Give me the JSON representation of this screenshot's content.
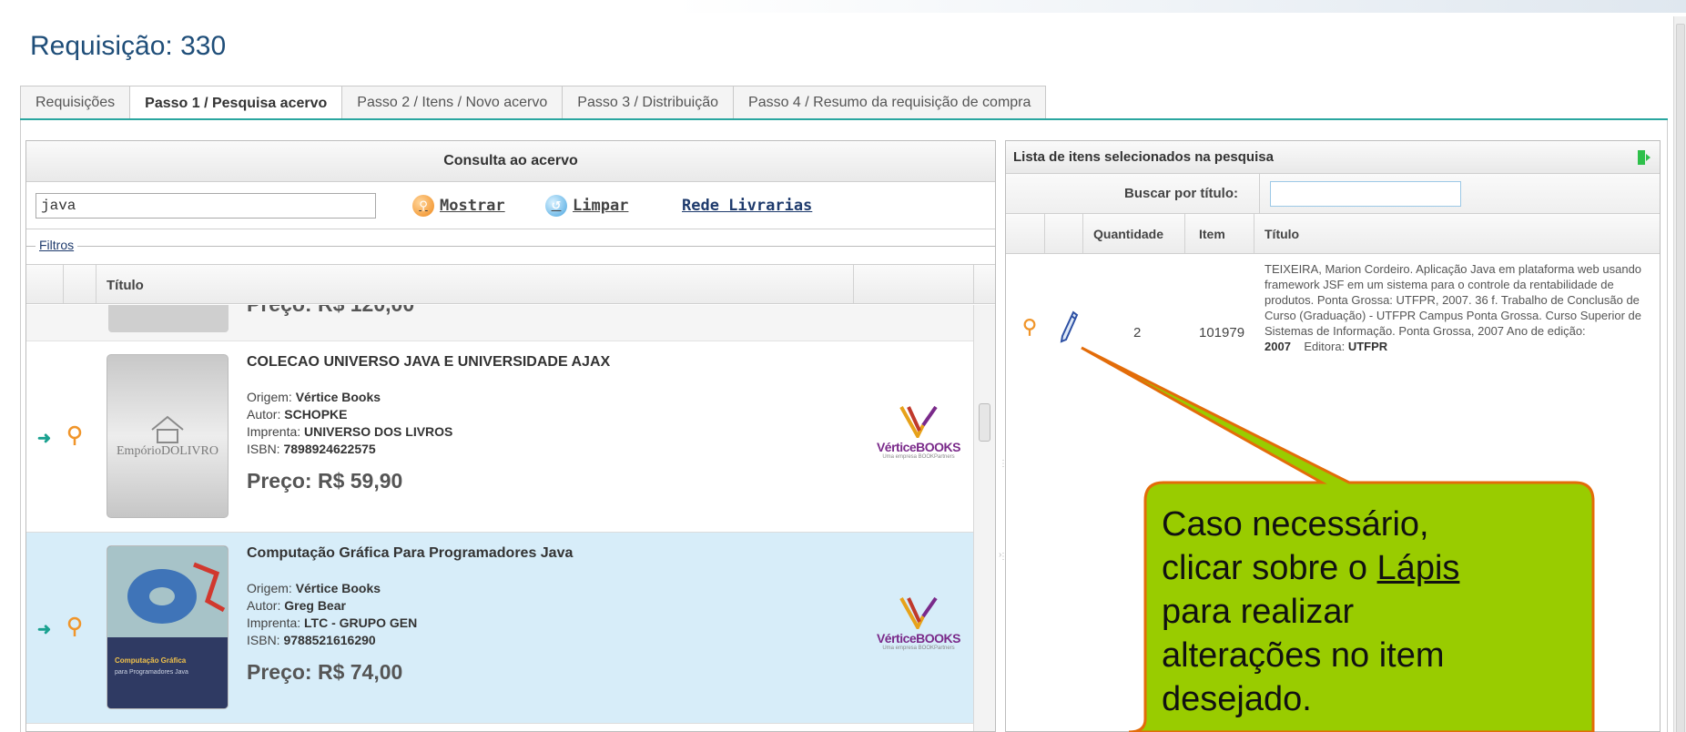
{
  "page": {
    "title": "Requisição: 330"
  },
  "tabs": [
    {
      "label": "Requisições"
    },
    {
      "label": "Passo 1 / Pesquisa acervo"
    },
    {
      "label": "Passo 2 / Itens / Novo acervo"
    },
    {
      "label": "Passo 3 / Distribuição"
    },
    {
      "label": "Passo 4 / Resumo da requisição de compra"
    }
  ],
  "left_panel": {
    "header": "Consulta ao acervo",
    "search_value": "java",
    "mostrar_label": "Mostrar",
    "limpar_label": "Limpar",
    "rede_label": "Rede Livrarias",
    "filtros_label": "Filtros",
    "col_titulo": "Título",
    "partial_price": "Preço: R$ 120,00",
    "rows": [
      {
        "title": "COLECAO UNIVERSO JAVA E UNIVERSIDADE AJAX",
        "origem_label": "Origem:",
        "origem": "Vértice Books",
        "autor_label": "Autor:",
        "autor": "SCHOPKE",
        "imprenta_label": "Imprenta:",
        "imprenta": "UNIVERSO DOS LIVROS",
        "isbn_label": "ISBN:",
        "isbn": "7898924622575",
        "price": "Preço: R$ 59,90",
        "cover_brand": "EmpórioDOLIVRO",
        "selected": false
      },
      {
        "title": "Computação Gráfica Para Programadores Java",
        "origem_label": "Origem:",
        "origem": "Vértice Books",
        "autor_label": "Autor:",
        "autor": "Greg Bear",
        "imprenta_label": "Imprenta:",
        "imprenta": "LTC - GRUPO GEN",
        "isbn_label": "ISBN:",
        "isbn": "9788521616290",
        "price": "Preço: R$ 74,00",
        "cover_brand": "Computação Gráfica para Programadores Java",
        "selected": true
      }
    ],
    "vendor_logo": "VérticeBOOKS",
    "vendor_sub": "Uma empresa BOOKPartners"
  },
  "right_panel": {
    "header": "Lista de itens selecionados na pesquisa",
    "search_label": "Buscar por título:",
    "search_value": "",
    "col_quantidade": "Quantidade",
    "col_item": "Item",
    "col_titulo": "Título",
    "row": {
      "quantidade": "2",
      "item": "101979",
      "descricao": "TEIXEIRA, Marion Cordeiro. Aplicação Java em plataforma web usando framework JSF em um sistema para o controle da rentabilidade de produtos. Ponta Grossa: UTFPR, 2007. 36 f. Trabalho de Conclusão de Curso (Graduação) - UTFPR Campus Ponta Grossa. Curso Superior de Sistemas de Informação. Ponta Grossa, 2007 Ano de edição:",
      "ano": "2007",
      "editora_label": "Editora:",
      "editora": "UTFPR"
    }
  },
  "callout": {
    "line1": "Caso necessário,",
    "line2_pre": "clicar sobre o ",
    "line2_link": "Lápis",
    "line3": "para realizar",
    "line4": "alterações no item",
    "line5": "desejado.",
    "fill": "#99cc00",
    "stroke": "#e36c09"
  },
  "colors": {
    "accent": "#2aa6a0",
    "title": "#1f4e79",
    "selected_row": "#d7edf9"
  }
}
